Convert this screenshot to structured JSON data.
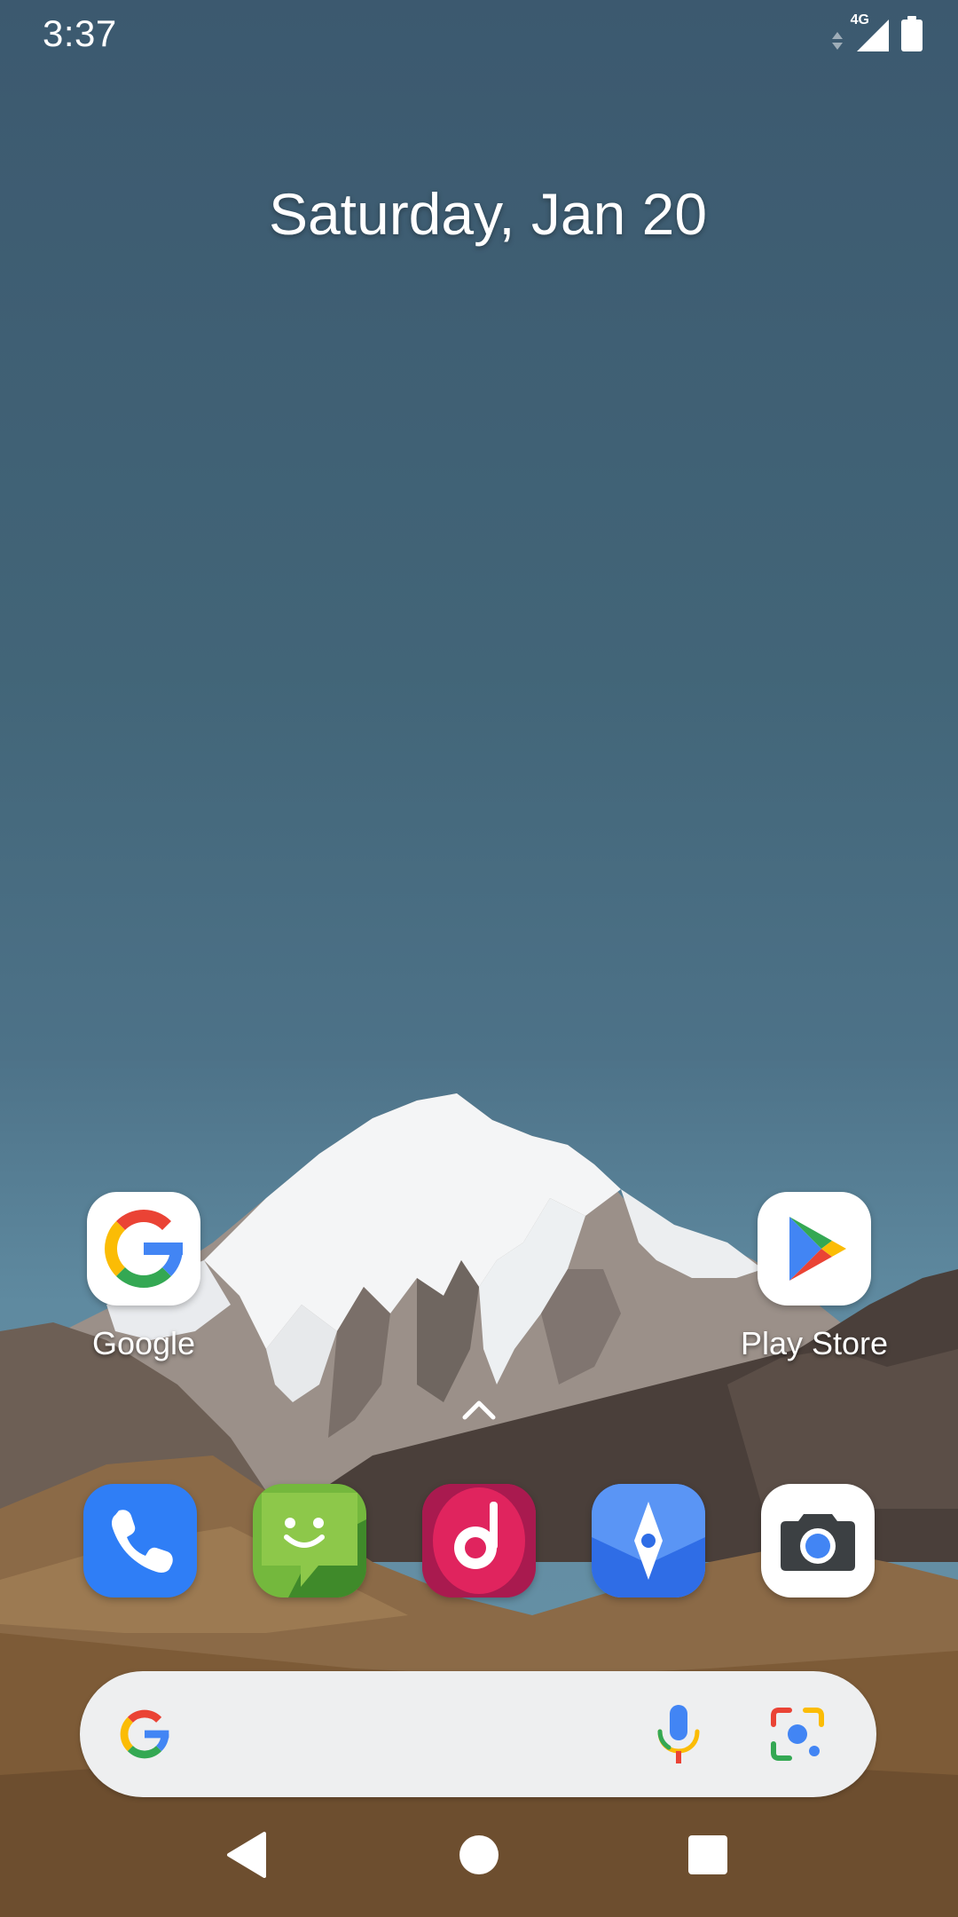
{
  "status_bar": {
    "time": "3:37",
    "network": "4G",
    "icons": [
      "data-arrows-icon",
      "signal-icon",
      "battery-icon"
    ]
  },
  "home": {
    "date": "Saturday, Jan 20",
    "top_apps": [
      {
        "label": "Google",
        "icon": "google-icon"
      },
      {
        "label": "Play Store",
        "icon": "play-store-icon"
      }
    ],
    "dock_apps": [
      {
        "icon": "phone-icon"
      },
      {
        "icon": "messages-icon"
      },
      {
        "icon": "music-icon"
      },
      {
        "icon": "maps-icon"
      },
      {
        "icon": "camera-icon"
      }
    ]
  },
  "search": {
    "icons": [
      "google-g-icon",
      "microphone-icon",
      "lens-icon"
    ]
  },
  "nav": {
    "icons": [
      "back-icon",
      "home-icon",
      "recents-icon"
    ]
  },
  "colors": {
    "sky": "#426578",
    "search_bar": "#eeeff0",
    "phone": "#2f7ef6",
    "messages": "#74b83d",
    "music": "#c81e5b",
    "maps": "#3b7bf0"
  }
}
